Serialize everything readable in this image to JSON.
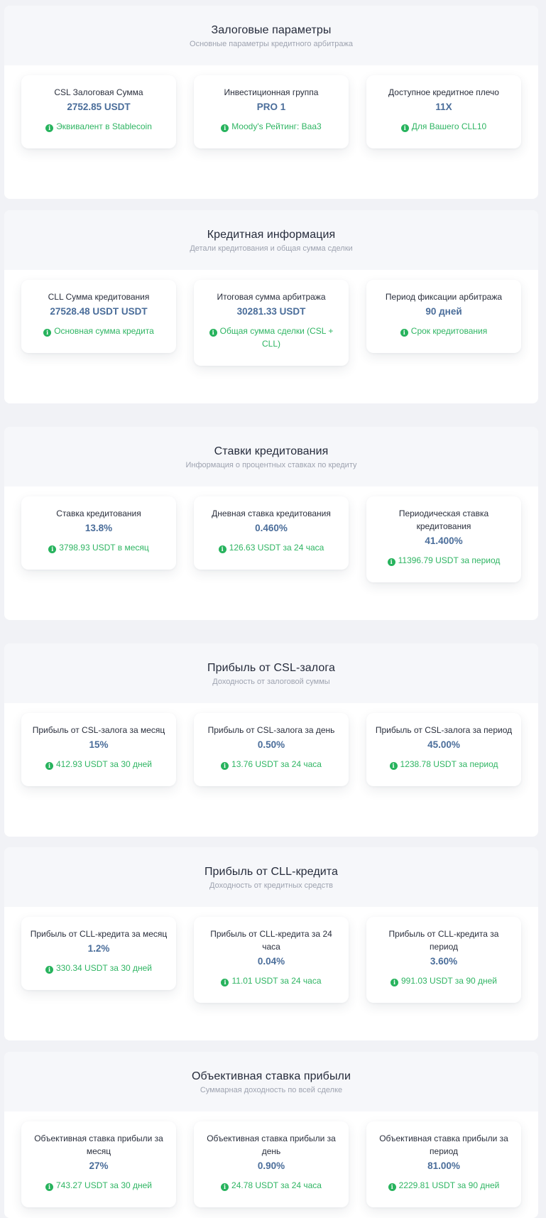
{
  "sections": [
    {
      "title": "Залоговые параметры",
      "subtitle": "Основные параметры кредитного арбитража",
      "cards": [
        {
          "label": "CSL Залоговая Сумма",
          "value": "2752.85 USDT",
          "note": "Эквивалент в Stablecoin"
        },
        {
          "label": "Инвестиционная группа",
          "value": "PRO 1",
          "note": "Moody's Рейтинг: Baa3"
        },
        {
          "label": "Доступное кредитное плечо",
          "value": "11X",
          "note": "Для Вашего CLL10"
        }
      ]
    },
    {
      "title": "Кредитная информация",
      "subtitle": "Детали кредитования и общая сумма сделки",
      "cards": [
        {
          "label": "CLL Сумма кредитования",
          "value": "27528.48 USDT USDT",
          "note": "Основная сумма кредита"
        },
        {
          "label": "Итоговая сумма арбитража",
          "value": "30281.33 USDT",
          "note": "Общая сумма сделки (CSL + CLL)"
        },
        {
          "label": "Период фиксации арбитража",
          "value": "90 дней",
          "note": "Срок кредитования"
        }
      ]
    },
    {
      "title": "Ставки кредитования",
      "subtitle": "Информация о процентных ставках по кредиту",
      "cards": [
        {
          "label": "Ставка кредитования",
          "value": "13.8%",
          "note": "3798.93 USDT в месяц"
        },
        {
          "label": "Дневная ставка кредитования",
          "value": "0.460%",
          "note": "126.63 USDT за 24 часа"
        },
        {
          "label": "Периодическая ставка кредитования",
          "value": "41.400%",
          "note": "11396.79 USDT за период"
        }
      ]
    },
    {
      "title": "Прибыль от CSL-залога",
      "subtitle": "Доходность от залоговой суммы",
      "cards": [
        {
          "label": "Прибыль от CSL-залога за месяц",
          "value": "15%",
          "note": "412.93 USDT за 30 дней"
        },
        {
          "label": "Прибыль от CSL-залога за день",
          "value": "0.50%",
          "note": "13.76 USDT за 24 часа"
        },
        {
          "label": "Прибыль от CSL-залога за период",
          "value": "45.00%",
          "note": "1238.78 USDT за период"
        }
      ]
    },
    {
      "title": "Прибыль от CLL-кредита",
      "subtitle": "Доходность от кредитных средств",
      "cards": [
        {
          "label": "Прибыль от CLL-кредита за месяц",
          "value": "1.2%",
          "note": "330.34 USDT за 30 дней"
        },
        {
          "label": "Прибыль от CLL-кредита за 24 часа",
          "value": "0.04%",
          "note": "11.01 USDT за 24 часа"
        },
        {
          "label": "Прибыль от CLL-кредита за период",
          "value": "3.60%",
          "note": "991.03 USDT за 90 дней"
        }
      ]
    },
    {
      "title": "Объективная ставка прибыли",
      "subtitle": "Суммарная доходность по всей сделке",
      "cards": [
        {
          "label": "Объективная ставка прибыли за месяц",
          "value": "27%",
          "note": "743.27 USDT за 30 дней"
        },
        {
          "label": "Объективная ставка прибыли за день",
          "value": "0.90%",
          "note": "24.78 USDT за 24 часа"
        },
        {
          "label": "Объективная ставка прибыли за период",
          "value": "81.00%",
          "note": "2229.81 USDT за 90 дней"
        }
      ]
    }
  ],
  "colors": {
    "page_background": "#f1f2f6",
    "header_background": "#f6f7fa",
    "value_blue": "#4a6d9a",
    "note_green": "#2fb563"
  },
  "icons": {
    "note": "info-icon"
  }
}
